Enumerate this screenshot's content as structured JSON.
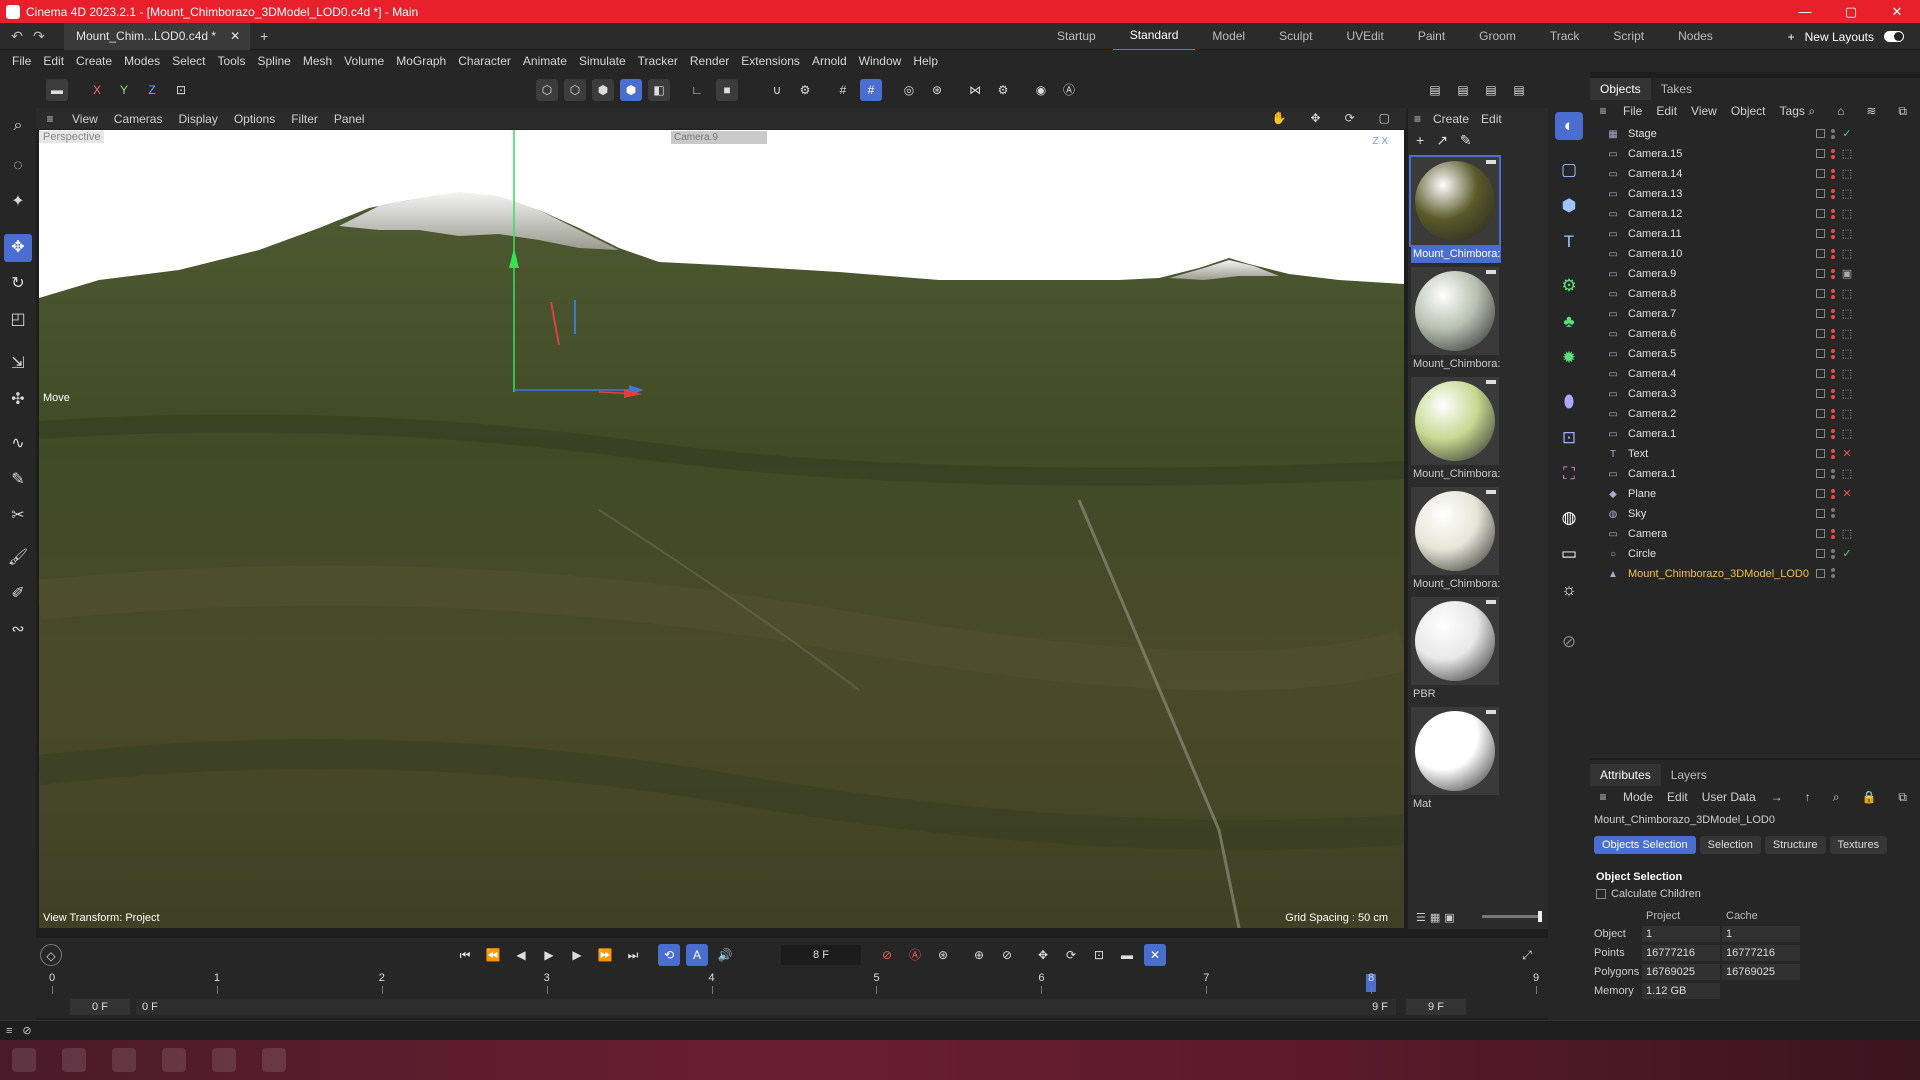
{
  "window": {
    "title": "Cinema 4D 2023.2.1 - [Mount_Chimborazo_3DModel_LOD0.c4d *] - Main",
    "controls": [
      "—",
      "▢",
      "✕"
    ]
  },
  "document_tab": {
    "label": "Mount_Chim...LOD0.c4d *",
    "close": "✕",
    "add": "+"
  },
  "layouts": {
    "items": [
      "Startup",
      "Standard",
      "Model",
      "Sculpt",
      "UVEdit",
      "Paint",
      "Groom",
      "Track",
      "Script",
      "Nodes"
    ],
    "active": "Standard",
    "add": "+",
    "new_layouts": "New Layouts"
  },
  "menubar": [
    "File",
    "Edit",
    "Create",
    "Modes",
    "Select",
    "Tools",
    "Spline",
    "Mesh",
    "Volume",
    "MoGraph",
    "Character",
    "Animate",
    "Simulate",
    "Tracker",
    "Render",
    "Extensions",
    "Arnold",
    "Window",
    "Help"
  ],
  "toolbar": {
    "axis_x": "X",
    "axis_y": "Y",
    "axis_z": "Z"
  },
  "viewport": {
    "menu": [
      "View",
      "Cameras",
      "Display",
      "Options",
      "Filter",
      "Panel"
    ],
    "projection_label": "Perspective",
    "camera_tag": "Camera.9",
    "tool_label": "Move",
    "view_transform": "View Transform: Project",
    "grid_spacing": "Grid Spacing : 50 cm",
    "axis_indicator": "Z X"
  },
  "material_panel": {
    "menu": [
      "Create",
      "Edit"
    ],
    "materials": [
      {
        "name": "Mount_Chimbora:",
        "selected": true,
        "color": "#5a5a2a"
      },
      {
        "name": "Mount_Chimbora:",
        "selected": false,
        "color": "#b8c0b0"
      },
      {
        "name": "Mount_Chimbora:",
        "selected": false,
        "color": "#c8d890"
      },
      {
        "name": "Mount_Chimbora:",
        "selected": false,
        "color": "#e6e6d8"
      },
      {
        "name": "PBR",
        "selected": false,
        "color": "#e8e8e8"
      },
      {
        "name": "Mat",
        "selected": false,
        "color": "#ffffff"
      }
    ]
  },
  "objects_panel": {
    "tabs": [
      "Objects",
      "Takes"
    ],
    "active_tab": "Objects",
    "menu": [
      "File",
      "Edit",
      "View",
      "Object",
      "Tags"
    ],
    "objects": [
      {
        "name": "Stage",
        "icon": "▦",
        "tag": "✓",
        "tag_type": "ok",
        "dots": "grey",
        "highlight": false
      },
      {
        "name": "Camera.15",
        "icon": "▭",
        "tag": "⬚",
        "tag_type": "fr",
        "dots": "red",
        "highlight": false
      },
      {
        "name": "Camera.14",
        "icon": "▭",
        "tag": "⬚",
        "tag_type": "fr",
        "dots": "red",
        "highlight": false
      },
      {
        "name": "Camera.13",
        "icon": "▭",
        "tag": "⬚",
        "tag_type": "fr",
        "dots": "red",
        "highlight": false
      },
      {
        "name": "Camera.12",
        "icon": "▭",
        "tag": "⬚",
        "tag_type": "fr",
        "dots": "red",
        "highlight": false
      },
      {
        "name": "Camera.11",
        "icon": "▭",
        "tag": "⬚",
        "tag_type": "fr",
        "dots": "red",
        "highlight": false
      },
      {
        "name": "Camera.10",
        "icon": "▭",
        "tag": "⬚",
        "tag_type": "fr",
        "dots": "red",
        "highlight": false
      },
      {
        "name": "Camera.9",
        "icon": "▭",
        "tag": "▣",
        "tag_type": "fr",
        "dots": "red",
        "highlight": false
      },
      {
        "name": "Camera.8",
        "icon": "▭",
        "tag": "⬚",
        "tag_type": "fr",
        "dots": "red",
        "highlight": false
      },
      {
        "name": "Camera.7",
        "icon": "▭",
        "tag": "⬚",
        "tag_type": "fr",
        "dots": "red",
        "highlight": false
      },
      {
        "name": "Camera.6",
        "icon": "▭",
        "tag": "⬚",
        "tag_type": "fr",
        "dots": "red",
        "highlight": false
      },
      {
        "name": "Camera.5",
        "icon": "▭",
        "tag": "⬚",
        "tag_type": "fr",
        "dots": "red",
        "highlight": false
      },
      {
        "name": "Camera.4",
        "icon": "▭",
        "tag": "⬚",
        "tag_type": "fr",
        "dots": "red",
        "highlight": false
      },
      {
        "name": "Camera.3",
        "icon": "▭",
        "tag": "⬚",
        "tag_type": "fr",
        "dots": "red",
        "highlight": false
      },
      {
        "name": "Camera.2",
        "icon": "▭",
        "tag": "⬚",
        "tag_type": "fr",
        "dots": "red",
        "highlight": false
      },
      {
        "name": "Camera.1",
        "icon": "▭",
        "tag": "⬚",
        "tag_type": "fr",
        "dots": "red",
        "highlight": false
      },
      {
        "name": "Text",
        "icon": "T",
        "tag": "✕",
        "tag_type": "x",
        "dots": "red",
        "highlight": false
      },
      {
        "name": "Camera.1",
        "icon": "▭",
        "tag": "⬚",
        "tag_type": "fr",
        "dots": "grey",
        "highlight": false
      },
      {
        "name": "Plane",
        "icon": "◆",
        "tag": "✕",
        "tag_type": "x",
        "dots": "red",
        "highlight": false
      },
      {
        "name": "Sky",
        "icon": "◍",
        "tag": "",
        "tag_type": "fr",
        "dots": "grey",
        "highlight": false
      },
      {
        "name": "Camera",
        "icon": "▭",
        "tag": "⬚",
        "tag_type": "fr",
        "dots": "red",
        "highlight": false
      },
      {
        "name": "Circle",
        "icon": "○",
        "tag": "✓",
        "tag_type": "ok",
        "dots": "grey",
        "highlight": false
      },
      {
        "name": "Mount_Chimborazo_3DModel_LOD0",
        "icon": "▲",
        "tag": "",
        "tag_type": "fr",
        "dots": "grey",
        "highlight": true
      }
    ]
  },
  "attributes_panel": {
    "tabs": [
      "Attributes",
      "Layers"
    ],
    "active_tab": "Attributes",
    "menu": [
      "Mode",
      "Edit",
      "User Data"
    ],
    "object_path": "Mount_Chimborazo_3DModel_LOD0",
    "sub_tabs": [
      "Objects Selection",
      "Selection",
      "Structure",
      "Textures"
    ],
    "active_sub_tab": "Objects Selection",
    "section_title": "Object Selection",
    "calculate_children": "Calculate Children",
    "col_project": "Project",
    "col_cache": "Cache",
    "rows": [
      {
        "label": "Object",
        "project": "1",
        "cache": "1"
      },
      {
        "label": "Points",
        "project": "16777216",
        "cache": "16777216"
      },
      {
        "label": "Polygons",
        "project": "16769025",
        "cache": "16769025"
      },
      {
        "label": "Memory",
        "project": "1.12 GB",
        "cache": ""
      }
    ]
  },
  "transport": {
    "current_frame": "8 F"
  },
  "timeline": {
    "ticks": [
      "0",
      "1",
      "2",
      "3",
      "4",
      "5",
      "6",
      "7",
      "8",
      "9"
    ],
    "playhead_frame": 8,
    "last_frame": 9
  },
  "range": {
    "start": "0 F",
    "range_start": "0 F",
    "range_end": "9 F",
    "end": "9 F"
  },
  "colors": {
    "titlebar": "#e8202c",
    "accent": "#4a6ed0",
    "panel": "#262626"
  }
}
